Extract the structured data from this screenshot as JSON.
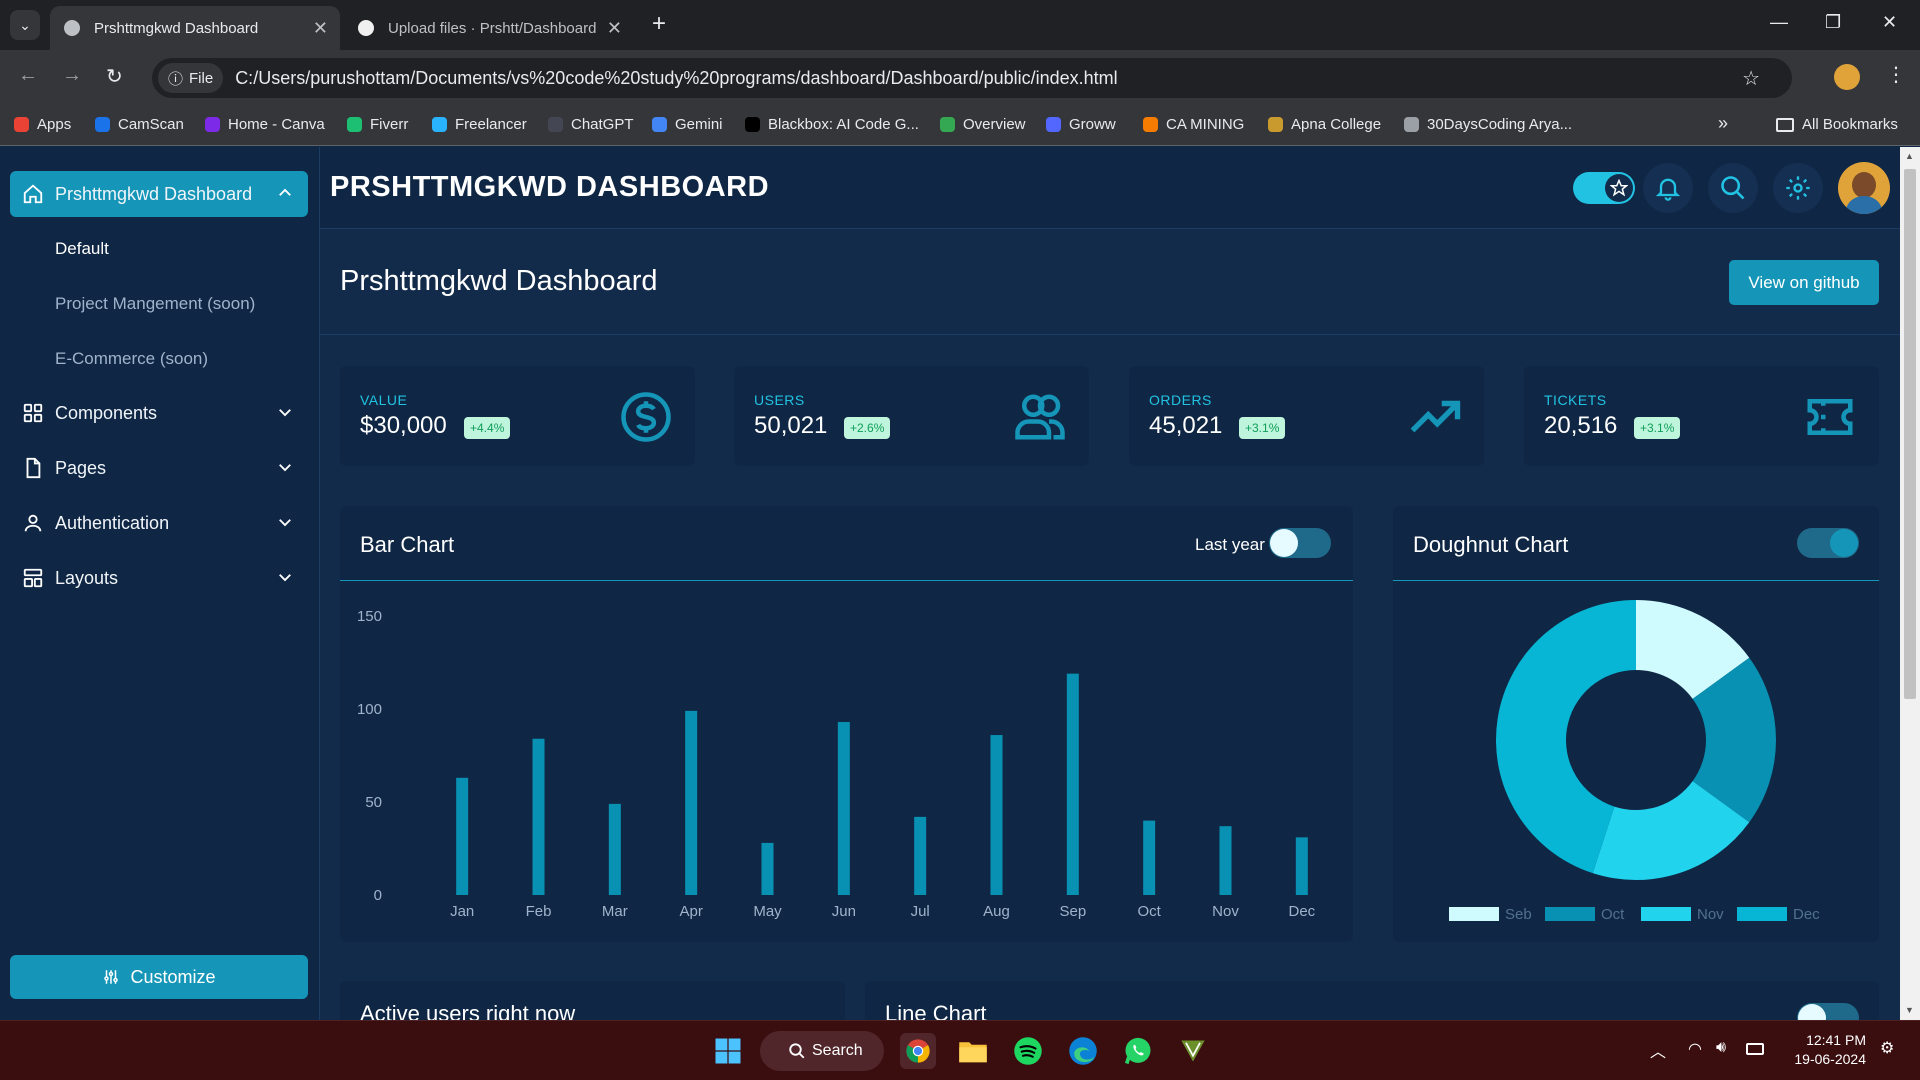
{
  "browser": {
    "tabs": [
      {
        "label": "Prshttmgkwd Dashboard",
        "active": true
      },
      {
        "label": "Upload files · Prshtt/Dashboard",
        "active": false
      }
    ],
    "new_tab": "+",
    "file_chip": "File",
    "url": "C:/Users/purushottam/Documents/vs%20code%20study%20programs/dashboard/Dashboard/public/index.html",
    "bookmarks": [
      {
        "label": "Apps",
        "icon": "apps-grid-icon",
        "color": "#ea4335"
      },
      {
        "label": "CamScan",
        "icon": "camscan-icon",
        "color": "#1a73e8"
      },
      {
        "label": "Home - Canva",
        "icon": "canva-icon",
        "color": "#7d2ae8"
      },
      {
        "label": "Fiverr",
        "icon": "fiverr-icon",
        "color": "#1dbf73"
      },
      {
        "label": "Freelancer",
        "icon": "freelancer-icon",
        "color": "#29b2fe"
      },
      {
        "label": "ChatGPT",
        "icon": "chatgpt-icon",
        "color": "#444654"
      },
      {
        "label": "Gemini",
        "icon": "gemini-icon",
        "color": "#4285f4"
      },
      {
        "label": "Blackbox: AI Code G...",
        "icon": "blackbox-icon",
        "color": "#000000"
      },
      {
        "label": "Overview",
        "icon": "overview-icon",
        "color": "#34a853"
      },
      {
        "label": "Groww",
        "icon": "groww-icon",
        "color": "#5367ff"
      },
      {
        "label": "CA MINING",
        "icon": "camining-icon",
        "color": "#f57c00"
      },
      {
        "label": "Apna College",
        "icon": "apnacollege-icon",
        "color": "#c99a2e"
      },
      {
        "label": "30DaysCoding Arya...",
        "icon": "globe-icon",
        "color": "#9aa0a6"
      }
    ],
    "more_bookmarks": "»",
    "all_bookmarks": "All Bookmarks"
  },
  "sidebar": {
    "main_item": "Prshttmgkwd Dashboard",
    "sub_items": [
      {
        "label": "Default",
        "color": "#ffffff"
      },
      {
        "label": "Project Mangement (soon)",
        "color": "#9fb4cc"
      },
      {
        "label": "E-Commerce (soon)",
        "color": "#9fb4cc"
      }
    ],
    "sections": [
      {
        "label": "Components",
        "icon": "grid-icon"
      },
      {
        "label": "Pages",
        "icon": "page-icon"
      },
      {
        "label": "Authentication",
        "icon": "user-icon"
      },
      {
        "label": "Layouts",
        "icon": "layout-icon"
      }
    ],
    "customize": "Customize"
  },
  "header": {
    "title": "PRSHTTMGKWD DASHBOARD"
  },
  "page": {
    "title": "Prshttmgkwd Dashboard",
    "github_button": "View on github"
  },
  "stats": [
    {
      "label": "VALUE",
      "value": "$30,000",
      "change": "+4.4%",
      "icon": "dollar-icon"
    },
    {
      "label": "USERS",
      "value": "50,021",
      "change": "+2.6%",
      "icon": "users-icon"
    },
    {
      "label": "ORDERS",
      "value": "45,021",
      "change": "+3.1%",
      "icon": "trending-up-icon"
    },
    {
      "label": "TICKETS",
      "value": "20,516",
      "change": "+3.1%",
      "icon": "ticket-icon"
    }
  ],
  "bar_card": {
    "title": "Bar Chart",
    "toggle_label": "Last year"
  },
  "doughnut_card": {
    "title": "Doughnut Chart"
  },
  "bottom_cards": {
    "active_users_title": "Active users right now",
    "line_chart_title": "Line Chart"
  },
  "colors": {
    "accent": "#1596b8",
    "background": "#132b4a",
    "card": "#0f2744"
  },
  "chart_data": [
    {
      "type": "bar",
      "categories": [
        "Jan",
        "Feb",
        "Mar",
        "Apr",
        "May",
        "Jun",
        "Jul",
        "Aug",
        "Sep",
        "Oct",
        "Nov",
        "Dec"
      ],
      "values": [
        63,
        84,
        49,
        99,
        28,
        93,
        42,
        86,
        119,
        40,
        37,
        31
      ],
      "ylim": [
        0,
        150
      ],
      "yticks": [
        0,
        50,
        100,
        150
      ],
      "color": "#0891b2"
    },
    {
      "type": "pie",
      "donut": true,
      "labels": [
        "Seb",
        "Oct",
        "Nov",
        "Dec"
      ],
      "values": [
        15,
        20,
        20,
        45
      ],
      "colors": [
        "#cffafe",
        "#0891b2",
        "#22d3ee",
        "#06b6d4"
      ]
    }
  ],
  "taskbar": {
    "search": "Search",
    "time": "12:41 PM",
    "date": "19-06-2024"
  }
}
